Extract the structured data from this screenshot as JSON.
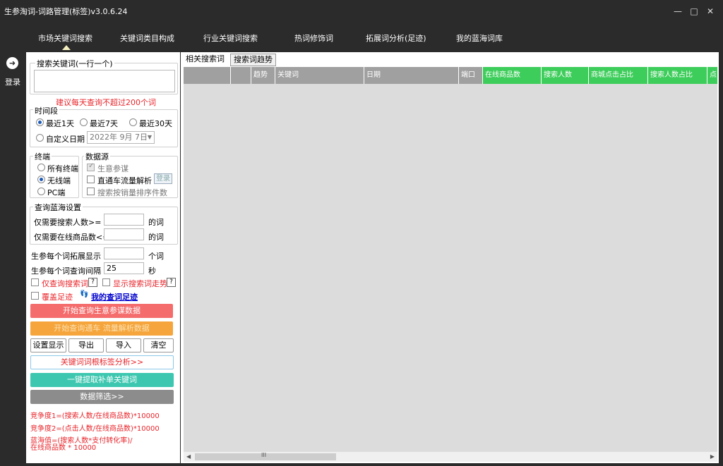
{
  "window": {
    "title": "生参淘词-词路管理(标签)v3.0.6.24",
    "min_glyph": "—",
    "max_glyph": "□",
    "close_glyph": "✕"
  },
  "nav": {
    "items": [
      "市场关键词搜索",
      "关键词类目构成",
      "行业关键词搜索",
      "热词修饰词",
      "拓展词分析(足迹)",
      "我的蓝海词库"
    ]
  },
  "rail": {
    "login_glyph": "➜",
    "login_label": "登录"
  },
  "sidebar": {
    "search_kw_legend": "搜索关键词(一行一个)",
    "search_kw_value": "",
    "scroll_up": "▲",
    "scroll_down": "▼",
    "hint": "建议每天查询不超过200个词",
    "period_legend": "时间段",
    "period_options": [
      "最近1天",
      "最近7天",
      "最近30天",
      "自定义日期"
    ],
    "period_selected": "最近1天",
    "custom_date": "2022年 9月 7日",
    "date_arrow": "▼",
    "terminal_legend": "终端",
    "terminal_options": [
      "所有终端",
      "无线端",
      "PC端"
    ],
    "terminal_selected": "无线端",
    "datasource_legend": "数据源",
    "datasource_options": [
      "生意参谋",
      "直通车流量解析",
      "搜索按销量排序件数"
    ],
    "login_mini": "登录",
    "bluesea_legend": "查询蓝海设置",
    "bluesea_min_search_label": "仅需要搜索人数>=",
    "bluesea_min_search_value": "",
    "bluesea_min_search_unit": "的词",
    "bluesea_max_goods_label": "仅需要在线商品数<=",
    "bluesea_max_goods_value": "",
    "bluesea_max_goods_unit": "的词",
    "expand_label": "生参每个词拓展显示",
    "expand_value": "",
    "expand_unit": "个词",
    "interval_label": "生参每个词查询间隔",
    "interval_value": "25",
    "interval_unit": "秒",
    "only_search_label": "仅查询搜索词",
    "show_trend_label": "显示搜索词走势",
    "question_mark": "?",
    "cover_footprint_label": "覆盖足迹",
    "footprint_glyph": "👣",
    "my_footprint_link": "我的查词足迹",
    "btn_start_sycm": "开始查询生意参谋数据",
    "btn_start_ztc": "开始查询通车 流量解析数据",
    "btn_settings": "设置显示",
    "btn_export": "导出",
    "btn_import": "导入",
    "btn_clear": "清空",
    "btn_root_analysis": "关键词词根标签分析>>",
    "btn_extract": "一键提取补单关键词",
    "btn_filter": "数据筛选>>",
    "formula1": "竞争度1=(搜索人数/在线商品数)*10000",
    "formula2": "竞争度2=(点击人数/在线商品数)*10000",
    "formula3_line1": "蓝海值=(搜索人数*支付转化率)/",
    "formula3_line2": "在线商品数 * 10000"
  },
  "main": {
    "tabs": [
      "相关搜索词",
      "搜索词趋势"
    ],
    "active_tab": "相关搜索词",
    "columns": [
      "",
      "",
      "趋势",
      "关键词",
      "日期",
      "端口",
      "在线商品数",
      "搜索人数",
      "商城点击占比",
      "搜索人数占比",
      "点"
    ],
    "scroll_left": "◀",
    "scroll_right": "▶",
    "scroll_grip": "III"
  },
  "colors": {
    "start_sycm": "#f56c6c",
    "start_ztc": "#f5a53c",
    "extract": "#3ec7b0",
    "filter": "#8c8c8c",
    "green_header": "#3dcd5a",
    "gray_header": "#a0a0a0"
  }
}
